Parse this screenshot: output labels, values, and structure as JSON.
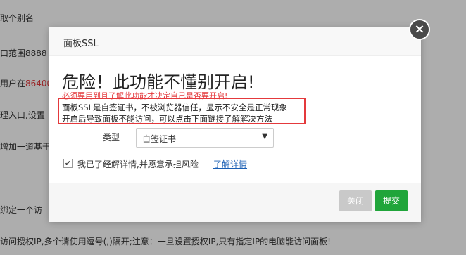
{
  "background": {
    "lines": [
      {
        "text": "取个别名"
      },
      {
        "text": "口范围8888"
      },
      {
        "pre": "用户在",
        "red": "86400"
      },
      {
        "text": "理入口,设置"
      },
      {
        "text": "增加一道基于"
      },
      {
        "text": "绑定一个访"
      },
      {
        "text": "访问授权IP,多个请使用逗号(,)隔开;注意：一旦设置授权IP,只有指定IP的电脑能访问面板!"
      }
    ]
  },
  "modal": {
    "title": "面板SSL",
    "close_symbol": "×",
    "danger_title": "危险！此功能不懂别开启!",
    "danger_subtitle": "必须要用到且了解此功能才决定自己是否要开启!",
    "warning_line1": "面板SSL是自签证书，不被浏览器信任，显示不安全是正常现象",
    "warning_line2": "开启后导致面板不能访问，可以点击下面链接了解解决方法",
    "type_label": "类型",
    "type_value": "自签证书",
    "agree_text": "我已了经解详情,并愿意承担风险",
    "agree_checked": true,
    "learn_link": "了解详情",
    "buttons": {
      "close": "关闭",
      "submit": "提交"
    },
    "colors": {
      "danger": "#e4393c",
      "submit": "#20a53a",
      "link": "#1a5fb4"
    }
  }
}
